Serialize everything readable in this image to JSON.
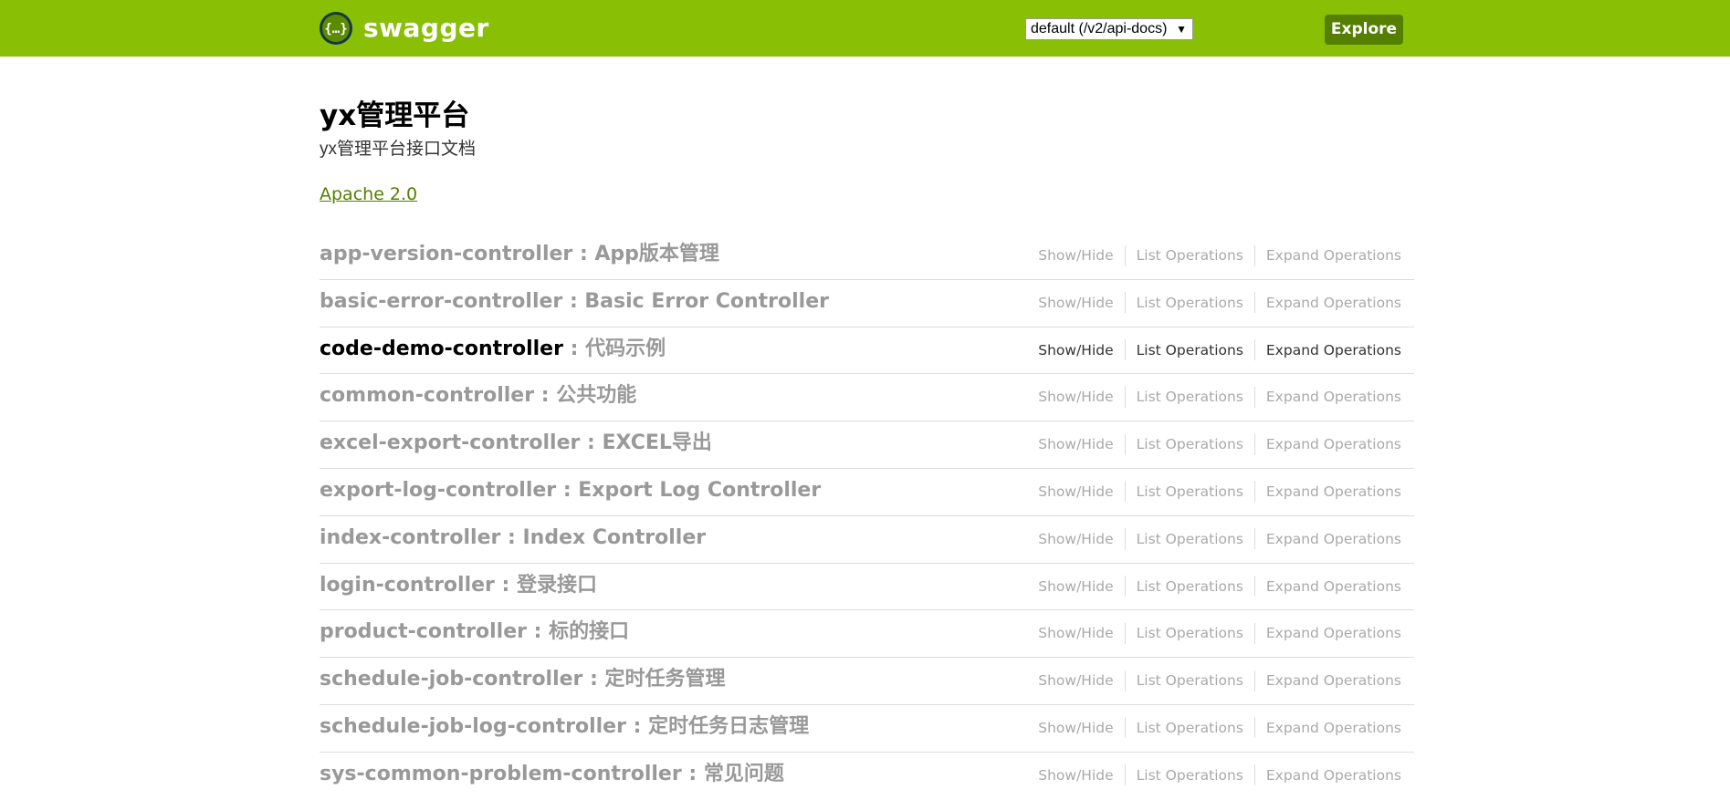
{
  "header": {
    "logo_text": "swagger",
    "logo_icon": "braces-icon",
    "api_select_value": "default (/v2/api-docs)",
    "explore_label": "Explore",
    "colors": {
      "header_bg": "#89bf04",
      "explore_bg": "#547f00"
    }
  },
  "info": {
    "title": "yx管理平台",
    "description": "yx管理平台接口文档",
    "license": "Apache 2.0"
  },
  "operations": {
    "show_hide": "Show/Hide",
    "list": "List Operations",
    "expand": "Expand Operations"
  },
  "resources": [
    {
      "name": "app-version-controller",
      "desc": "App版本管理"
    },
    {
      "name": "basic-error-controller",
      "desc": "Basic Error Controller"
    },
    {
      "name": "code-demo-controller",
      "desc": "代码示例"
    },
    {
      "name": "common-controller",
      "desc": "公共功能"
    },
    {
      "name": "excel-export-controller",
      "desc": "EXCEL导出"
    },
    {
      "name": "export-log-controller",
      "desc": "Export Log Controller"
    },
    {
      "name": "index-controller",
      "desc": "Index Controller"
    },
    {
      "name": "login-controller",
      "desc": "登录接口"
    },
    {
      "name": "product-controller",
      "desc": "标的接口"
    },
    {
      "name": "schedule-job-controller",
      "desc": "定时任务管理"
    },
    {
      "name": "schedule-job-log-controller",
      "desc": "定时任务日志管理"
    },
    {
      "name": "sys-common-problem-controller",
      "desc": "常见问题"
    }
  ],
  "separator": " : "
}
